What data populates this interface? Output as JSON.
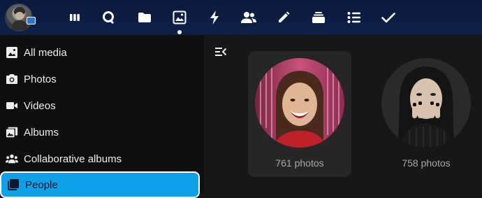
{
  "header": {
    "apps": [
      {
        "name": "dashboard",
        "icon": "dashboard-icon"
      },
      {
        "name": "search",
        "icon": "search-icon"
      },
      {
        "name": "files",
        "icon": "folder-icon"
      },
      {
        "name": "photos",
        "icon": "image-icon",
        "active": true
      },
      {
        "name": "activity",
        "icon": "lightning-icon"
      },
      {
        "name": "contacts",
        "icon": "contacts-icon"
      },
      {
        "name": "notes",
        "icon": "pencil-icon"
      },
      {
        "name": "deck",
        "icon": "deck-icon"
      },
      {
        "name": "list",
        "icon": "list-icon"
      },
      {
        "name": "tasks",
        "icon": "checkmark-icon"
      }
    ]
  },
  "sidebar": {
    "items": [
      {
        "label": "All media",
        "icon": "image-icon"
      },
      {
        "label": "Photos",
        "icon": "camera-icon"
      },
      {
        "label": "Videos",
        "icon": "video-icon"
      },
      {
        "label": "Albums",
        "icon": "albums-icon"
      },
      {
        "label": "Collaborative albums",
        "icon": "group-icon"
      },
      {
        "label": "People",
        "icon": "people-icon",
        "selected": true
      }
    ]
  },
  "main": {
    "people": [
      {
        "count_label": "761 photos"
      },
      {
        "count_label": "758 photos"
      }
    ]
  },
  "colors": {
    "header": "#0d2148",
    "selected_nav": "#0ea1e9",
    "background": "#171717",
    "sidebar": "#0f0f0f"
  }
}
